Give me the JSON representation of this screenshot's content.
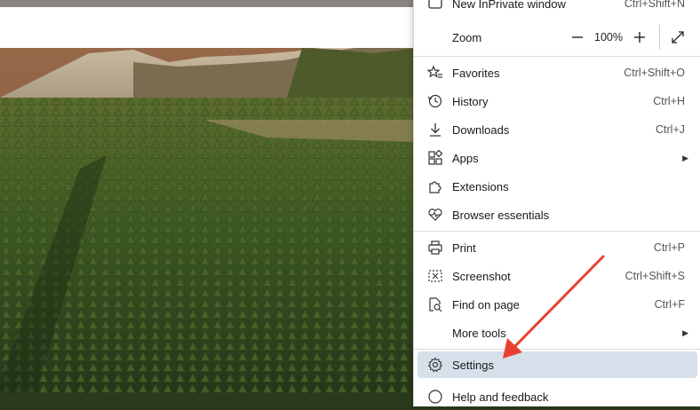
{
  "menu": {
    "new_inprivate": {
      "label": "New InPrivate window",
      "shortcut": "Ctrl+Shift+N"
    },
    "zoom": {
      "label": "Zoom",
      "value": "100%",
      "minus": "—",
      "plus": "+"
    },
    "items1": [
      {
        "label": "Favorites",
        "shortcut": "Ctrl+Shift+O",
        "icon": "star-list-icon"
      },
      {
        "label": "History",
        "shortcut": "Ctrl+H",
        "icon": "history-icon"
      },
      {
        "label": "Downloads",
        "shortcut": "Ctrl+J",
        "icon": "download-icon"
      },
      {
        "label": "Apps",
        "shortcut": "",
        "icon": "apps-icon"
      },
      {
        "label": "Extensions",
        "shortcut": "",
        "icon": "puzzle-icon"
      },
      {
        "label": "Browser essentials",
        "shortcut": "",
        "icon": "heart-pulse-icon"
      }
    ],
    "items2": [
      {
        "label": "Print",
        "shortcut": "Ctrl+P",
        "icon": "printer-icon"
      },
      {
        "label": "Screenshot",
        "shortcut": "Ctrl+Shift+S",
        "icon": "screenshot-icon"
      },
      {
        "label": "Find on page",
        "shortcut": "Ctrl+F",
        "icon": "find-icon"
      },
      {
        "label": "More tools",
        "shortcut": "",
        "icon": "tools-icon"
      }
    ],
    "settings": {
      "label": "Settings",
      "icon": "gear-icon"
    },
    "help": {
      "label": "Help and feedback",
      "icon": "help-icon"
    }
  },
  "colors": {
    "highlight": "#d6e0ea",
    "arrow": "#e8402f"
  }
}
